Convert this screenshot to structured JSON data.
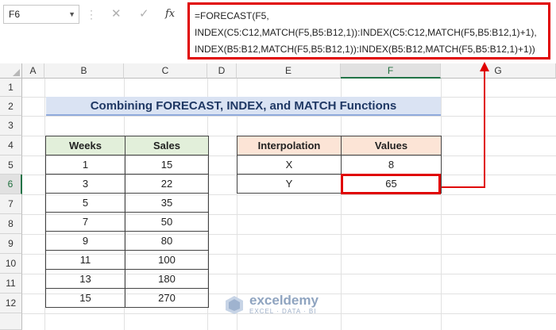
{
  "formula_bar": {
    "name_box": "F6",
    "fx_label": "fx",
    "formula_lines": [
      "=FORECAST(F5,",
      "INDEX(C5:C12,MATCH(F5,B5:B12,1)):INDEX(C5:C12,MATCH(F5,B5:B12,1)+1),",
      "INDEX(B5:B12,MATCH(F5,B5:B12,1)):INDEX(B5:B12,MATCH(F5,B5:B12,1)+1))"
    ]
  },
  "columns": [
    "A",
    "B",
    "C",
    "D",
    "E",
    "F",
    "G"
  ],
  "rows": [
    "1",
    "2",
    "3",
    "4",
    "5",
    "6",
    "7",
    "8",
    "9",
    "10",
    "11",
    "12"
  ],
  "title": "Combining FORECAST, INDEX, and MATCH Functions",
  "sales_table": {
    "headers": [
      "Weeks",
      "Sales"
    ],
    "rows": [
      [
        "1",
        "15"
      ],
      [
        "3",
        "22"
      ],
      [
        "5",
        "35"
      ],
      [
        "7",
        "50"
      ],
      [
        "9",
        "80"
      ],
      [
        "11",
        "100"
      ],
      [
        "13",
        "180"
      ],
      [
        "15",
        "270"
      ]
    ]
  },
  "interp_table": {
    "headers": [
      "Interpolation",
      "Values"
    ],
    "rows": [
      [
        "X",
        "8"
      ],
      [
        "Y",
        "65"
      ]
    ]
  },
  "watermark": {
    "name": "exceldemy",
    "tagline": "EXCEL · DATA · BI"
  },
  "colors": {
    "highlight": "#e00000",
    "title_bg": "#dae3f3",
    "green_header": "#e2efda",
    "peach_header": "#fce4d6"
  }
}
